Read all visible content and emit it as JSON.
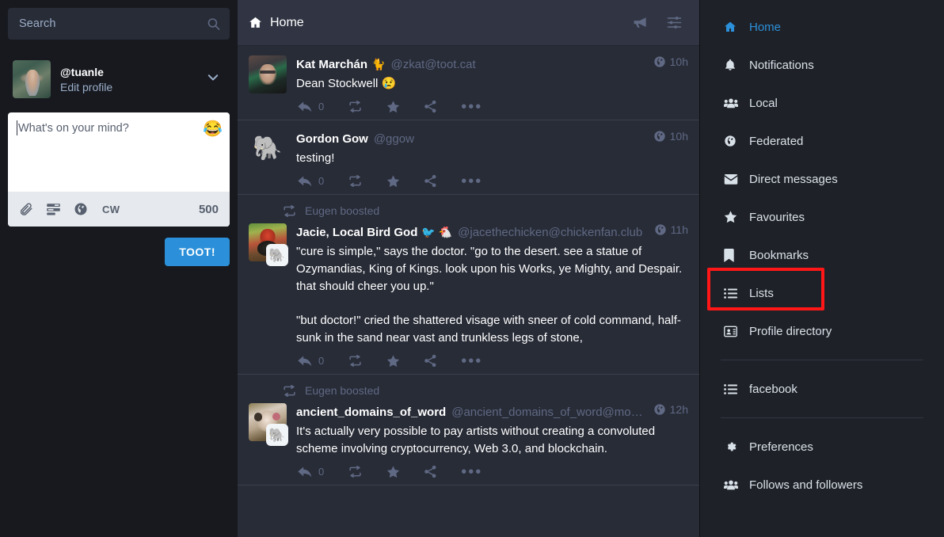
{
  "search": {
    "placeholder": "Search",
    "icon": "search-icon"
  },
  "account": {
    "username": "@tuanle",
    "edit_profile": "Edit profile",
    "chevron": "chevron-down-icon"
  },
  "compose": {
    "placeholder": "What's on your mind?",
    "emoji": "😂",
    "buttons": [
      {
        "name": "attach-icon",
        "label": ""
      },
      {
        "name": "poll-icon",
        "label": ""
      },
      {
        "name": "visibility-globe-icon",
        "label": ""
      },
      {
        "name": "content-warning-button",
        "label": "CW"
      }
    ],
    "char_counter": "500",
    "submit_label": "TOOT!",
    "accent_color": "#2b90d9"
  },
  "column": {
    "title": "Home",
    "home_icon": "home-icon",
    "actions": [
      {
        "name": "announcements-megaphone-icon"
      },
      {
        "name": "column-settings-sliders-icon"
      }
    ]
  },
  "statuses": [
    {
      "boosted_by": null,
      "display_name": "Kat Marchán",
      "name_emoji": "🐈",
      "acct": "@zkat@toot.cat",
      "timestamp": "10h",
      "visibility_icon": "globe-icon",
      "avatar_kind": "photo-green-hair",
      "has_boost_badge": false,
      "content": [
        "Dean Stockwell 😢"
      ],
      "actions": {
        "reply_count": "0"
      }
    },
    {
      "boosted_by": null,
      "display_name": "Gordon Gow",
      "name_emoji": "",
      "acct": "@ggow",
      "timestamp": "10h",
      "visibility_icon": "globe-icon",
      "avatar_kind": "mastodon-mascot",
      "has_boost_badge": false,
      "content": [
        "testing!"
      ],
      "actions": {
        "reply_count": "0"
      }
    },
    {
      "boosted_by": "Eugen boosted",
      "display_name": "Jacie, Local Bird God",
      "name_emoji": "🐦 🐔",
      "acct": "@jacethechicken@chickenfan.club",
      "timestamp": "11h",
      "visibility_icon": "globe-icon",
      "avatar_kind": "rooster-photo",
      "has_boost_badge": true,
      "content": [
        "\"cure is simple,\" says the doctor. \"go to the desert. see a statue of Ozymandias, King of Kings. look upon his Works, ye Mighty, and Despair. that should cheer you up.\"",
        "\"but doctor!\" cried the shattered visage with sneer of cold command, half-sunk in the sand near vast and trunkless legs of stone,"
      ],
      "actions": {
        "reply_count": "0"
      }
    },
    {
      "boosted_by": "Eugen boosted",
      "display_name": "ancient_domains_of_word",
      "name_emoji": "",
      "acct": "@ancient_domains_of_word@monads.o…",
      "timestamp": "12h",
      "visibility_icon": "globe-icon",
      "avatar_kind": "cow-photo",
      "has_boost_badge": true,
      "content": [
        "It's actually very possible to pay artists without creating a convoluted scheme involving cryptocurrency, Web 3.0, and blockchain."
      ],
      "actions": {
        "reply_count": "0"
      }
    }
  ],
  "nav": {
    "items": [
      {
        "label": "Home",
        "icon": "home-icon",
        "active": true
      },
      {
        "label": "Notifications",
        "icon": "bell-icon",
        "active": false
      },
      {
        "label": "Local",
        "icon": "users-icon",
        "active": false
      },
      {
        "label": "Federated",
        "icon": "globe-icon",
        "active": false
      },
      {
        "label": "Direct messages",
        "icon": "envelope-icon",
        "active": false
      },
      {
        "label": "Favourites",
        "icon": "star-icon",
        "active": false
      },
      {
        "label": "Bookmarks",
        "icon": "bookmark-icon",
        "active": false
      },
      {
        "label": "Lists",
        "icon": "list-icon",
        "active": false
      },
      {
        "label": "Profile directory",
        "icon": "address-card-icon",
        "active": false
      }
    ],
    "lists": [
      {
        "label": "facebook",
        "icon": "list-icon"
      }
    ],
    "footer": [
      {
        "label": "Preferences",
        "icon": "gear-icon"
      },
      {
        "label": "Follows and followers",
        "icon": "users-icon"
      }
    ],
    "highlight": {
      "target": "Lists",
      "color": "#ff1717"
    }
  }
}
